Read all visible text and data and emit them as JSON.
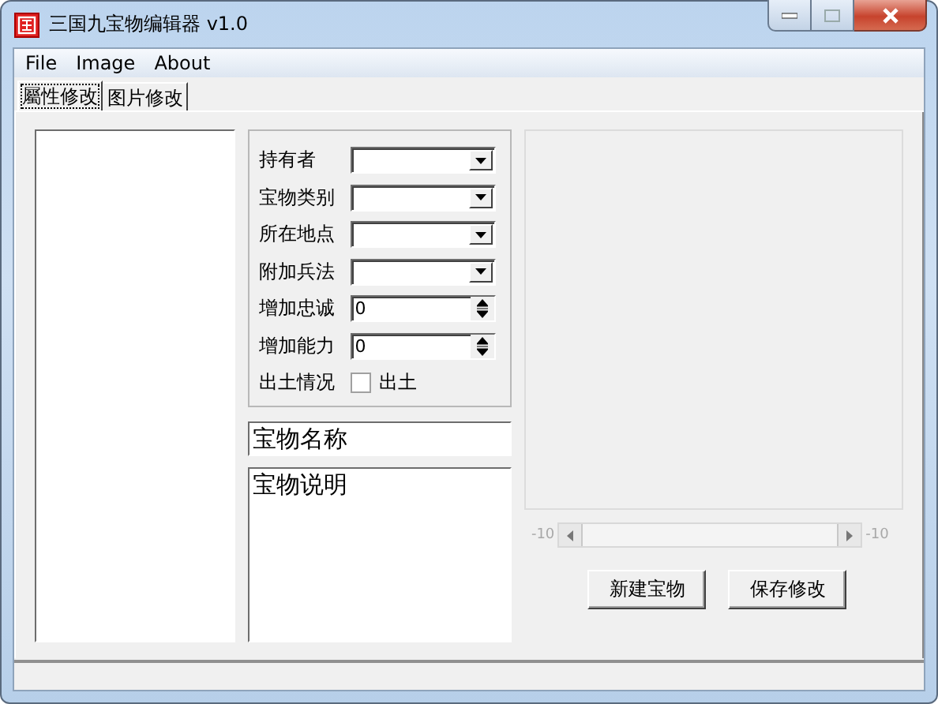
{
  "window": {
    "title": "三国九宝物编辑器 v1.0"
  },
  "menu": [
    "File",
    "Image",
    "About"
  ],
  "tabs": [
    {
      "label": "屬性修改",
      "selected": true
    },
    {
      "label": "图片修改",
      "selected": false
    }
  ],
  "properties": [
    {
      "kind": "combo",
      "label": "持有者"
    },
    {
      "kind": "combo",
      "label": "宝物类别"
    },
    {
      "kind": "combo",
      "label": "所在地点"
    },
    {
      "kind": "combo",
      "label": "附加兵法"
    },
    {
      "kind": "spin",
      "label": "增加忠诚",
      "value": "0"
    },
    {
      "kind": "spin",
      "label": "增加能力",
      "value": "0"
    },
    {
      "kind": "check",
      "label": "出土情况",
      "option": "出土",
      "checked": false
    }
  ],
  "name_field": {
    "value": "宝物名称"
  },
  "description_field": {
    "value": "宝物说明"
  },
  "scrollbar": {
    "min_label": "-10",
    "max_label": "-10"
  },
  "buttons": [
    "新建宝物",
    "保存修改"
  ]
}
